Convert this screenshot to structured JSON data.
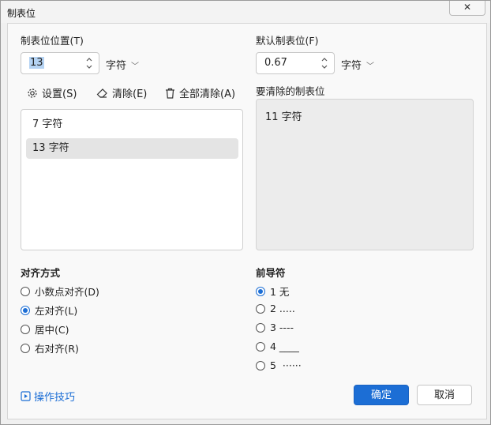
{
  "window": {
    "title": "制表位",
    "close_glyph": "✕"
  },
  "tab_position": {
    "label": "制表位位置(T)",
    "value": "13",
    "unit": "字符"
  },
  "default_tab": {
    "label": "默认制表位(F)",
    "value": "0.67",
    "unit": "字符"
  },
  "toolbar": {
    "set_label": "设置(S)",
    "clear_label": "清除(E)",
    "clear_all_label": "全部清除(A)"
  },
  "tab_list": {
    "items": [
      {
        "label": "7 字符",
        "selected": false
      },
      {
        "label": "13 字符",
        "selected": true
      }
    ]
  },
  "to_clear": {
    "label": "要清除的制表位",
    "items": [
      "11 字符"
    ]
  },
  "alignment": {
    "label": "对齐方式",
    "options": [
      {
        "label": "小数点对齐(D)",
        "checked": false
      },
      {
        "label": "左对齐(L)",
        "checked": true
      },
      {
        "label": "居中(C)",
        "checked": false
      },
      {
        "label": "右对齐(R)",
        "checked": false
      }
    ]
  },
  "leader": {
    "label": "前导符",
    "options": [
      {
        "label": "1 无",
        "checked": true
      },
      {
        "label": "2 .....",
        "checked": false
      },
      {
        "label": "3 ----",
        "checked": false
      },
      {
        "label": "4 ____",
        "checked": false
      },
      {
        "label": "5  ······",
        "checked": false
      }
    ]
  },
  "footer": {
    "tips_label": "操作技巧",
    "ok_label": "确定",
    "cancel_label": "取消"
  },
  "colors": {
    "accent": "#1c6ed5"
  }
}
